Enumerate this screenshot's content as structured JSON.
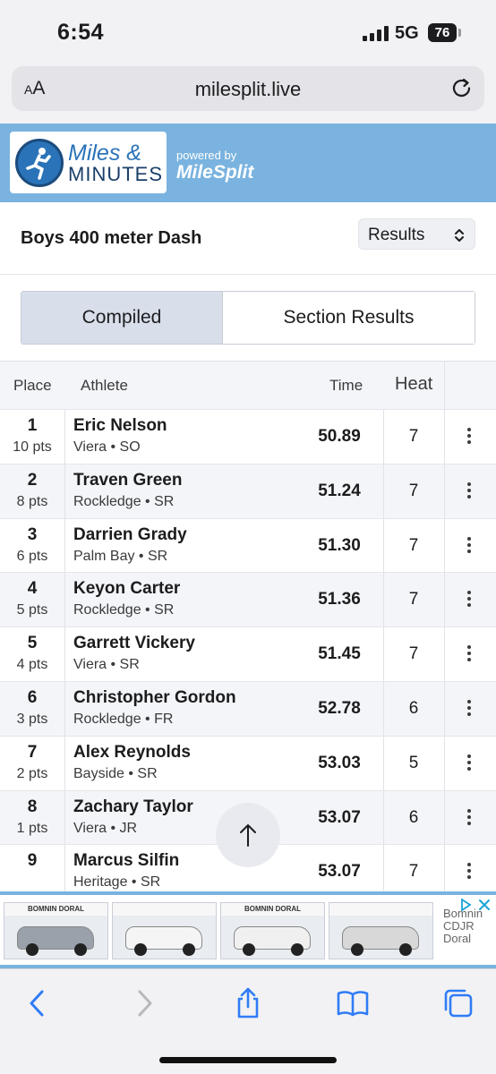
{
  "status_bar": {
    "time": "6:54",
    "network": "5G",
    "battery": "76"
  },
  "browser": {
    "text_size_label_small": "A",
    "text_size_label_large": "A",
    "url": "milesplit.live"
  },
  "banner": {
    "logo_line1": "Miles &",
    "logo_line2": "MINUTES",
    "powered_by": "powered by",
    "partner_logo": "MileSplit",
    "background_color": "#7ab3df"
  },
  "event": {
    "title": "Boys 400 meter Dash",
    "view_select": "Results"
  },
  "toggle": {
    "compiled": "Compiled",
    "section_results": "Section Results",
    "active": "compiled"
  },
  "table": {
    "headers": {
      "place": "Place",
      "athlete": "Athlete",
      "time": "Time",
      "heat": "Heat"
    },
    "rows": [
      {
        "place": "1",
        "pts": "10 pts",
        "name": "Eric Nelson",
        "team": "Viera • SO",
        "time": "50.89",
        "heat": "7"
      },
      {
        "place": "2",
        "pts": "8 pts",
        "name": "Traven Green",
        "team": "Rockledge • SR",
        "time": "51.24",
        "heat": "7"
      },
      {
        "place": "3",
        "pts": "6 pts",
        "name": "Darrien Grady",
        "team": "Palm Bay • SR",
        "time": "51.30",
        "heat": "7"
      },
      {
        "place": "4",
        "pts": "5 pts",
        "name": "Keyon Carter",
        "team": "Rockledge • SR",
        "time": "51.36",
        "heat": "7"
      },
      {
        "place": "5",
        "pts": "4 pts",
        "name": "Garrett Vickery",
        "team": "Viera • SR",
        "time": "51.45",
        "heat": "7"
      },
      {
        "place": "6",
        "pts": "3 pts",
        "name": "Christopher Gordon",
        "team": "Rockledge • FR",
        "time": "52.78",
        "heat": "6"
      },
      {
        "place": "7",
        "pts": "2 pts",
        "name": "Alex Reynolds",
        "team": "Bayside • SR",
        "time": "53.03",
        "heat": "5"
      },
      {
        "place": "8",
        "pts": "1 pts",
        "name": "Zachary Taylor",
        "team": "Viera • JR",
        "time": "53.07",
        "heat": "6"
      },
      {
        "place": "9",
        "pts": "",
        "name": "Marcus Silfin",
        "team": "Heritage • SR",
        "time": "53.07",
        "heat": "7"
      }
    ]
  },
  "ad": {
    "tiles": [
      {
        "sign": "BOMNIN DORAL",
        "car_color": "#9aa1aa"
      },
      {
        "sign": "",
        "car_color": "#f5f5f5"
      },
      {
        "sign": "BOMNIN DORAL",
        "car_color": "#f0f0f0"
      },
      {
        "sign": "",
        "car_color": "#d8d8d8"
      }
    ],
    "side_text": [
      "Bomnin",
      "CDJR",
      "Doral"
    ]
  },
  "toolbar": {
    "icons": [
      "back-icon",
      "forward-icon",
      "share-icon",
      "bookmarks-icon",
      "tabs-icon"
    ]
  }
}
